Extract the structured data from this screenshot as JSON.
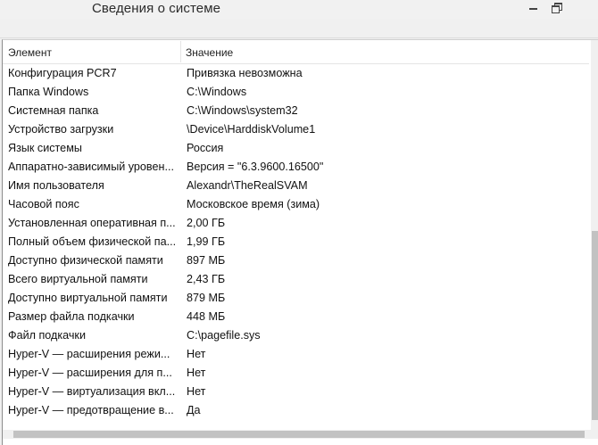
{
  "window": {
    "title": "Сведения о системе",
    "minimize_icon": "minimize-icon",
    "restore_icon": "restore-icon"
  },
  "table": {
    "columns": [
      "Элемент",
      "Значение"
    ],
    "rows": [
      {
        "k": "Конфигурация PCR7",
        "v": "Привязка невозможна"
      },
      {
        "k": "Папка Windows",
        "v": "C:\\Windows"
      },
      {
        "k": "Системная папка",
        "v": "C:\\Windows\\system32"
      },
      {
        "k": "Устройство загрузки",
        "v": "\\Device\\HarddiskVolume1"
      },
      {
        "k": "Язык системы",
        "v": "Россия"
      },
      {
        "k": "Аппаратно-зависимый уровен...",
        "v": "Версия = \"6.3.9600.16500\""
      },
      {
        "k": "Имя пользователя",
        "v": "Alexandr\\TheRealSVAM"
      },
      {
        "k": "Часовой пояс",
        "v": "Московское время (зима)"
      },
      {
        "k": "Установленная оперативная п...",
        "v": "2,00 ГБ"
      },
      {
        "k": "Полный объем физической па...",
        "v": "1,99 ГБ"
      },
      {
        "k": "Доступно физической памяти",
        "v": "897 МБ"
      },
      {
        "k": "Всего виртуальной памяти",
        "v": "2,43 ГБ"
      },
      {
        "k": "Доступно виртуальной памяти",
        "v": "879 МБ"
      },
      {
        "k": "Размер файла подкачки",
        "v": "448 МБ"
      },
      {
        "k": "Файл подкачки",
        "v": "C:\\pagefile.sys"
      },
      {
        "k": "Hyper-V — расширения режи...",
        "v": "Нет"
      },
      {
        "k": "Hyper-V — расширения для п...",
        "v": "Нет"
      },
      {
        "k": "Hyper-V — виртуализация вкл...",
        "v": "Нет"
      },
      {
        "k": "Hyper-V — предотвращение в...",
        "v": "Да"
      }
    ]
  }
}
